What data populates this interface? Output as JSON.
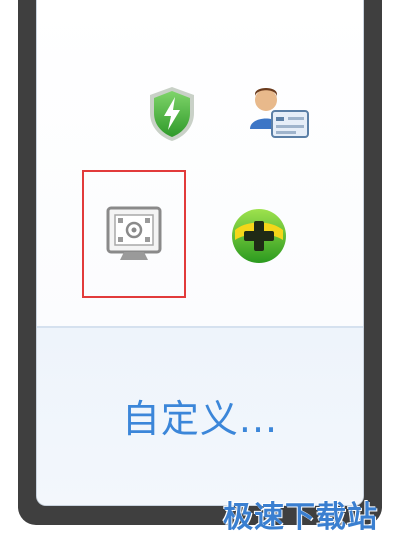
{
  "tray_overflow": {
    "icons": [
      {
        "name": "security-shield-icon",
        "selected": false
      },
      {
        "name": "user-contact-card-icon",
        "selected": false
      },
      {
        "name": "camera-display-icon",
        "selected": true
      },
      {
        "name": "green-plus-icon",
        "selected": false
      }
    ],
    "customize_label": "自定义..."
  },
  "watermark": {
    "text": "极速下载站"
  },
  "colors": {
    "selection_border": "#e23b3b",
    "link_blue": "#3b86d9",
    "frame_dark": "#3f3f3f",
    "footer_bg": "#eef4fb"
  }
}
